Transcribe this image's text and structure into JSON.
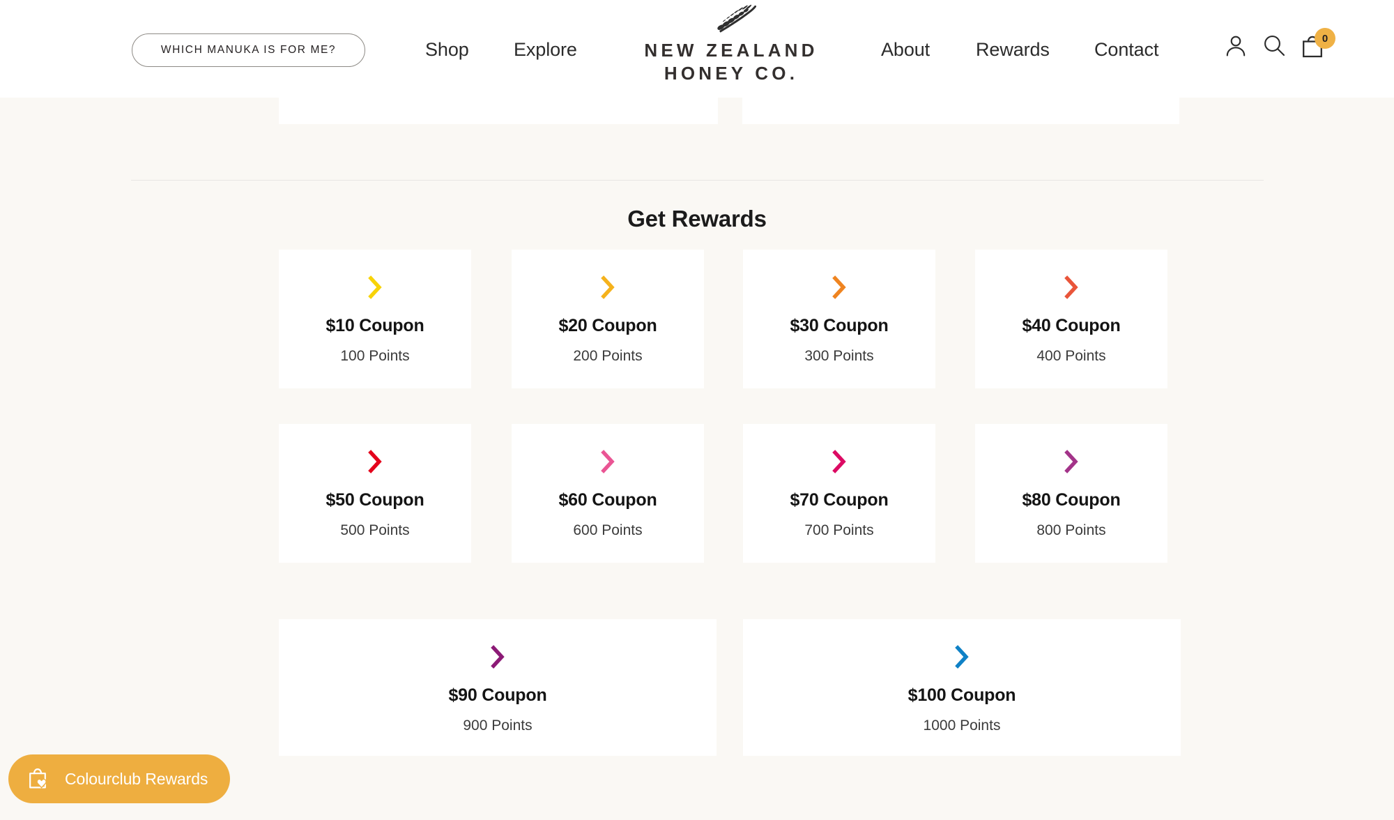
{
  "header": {
    "cta_button": "WHICH MANUKA IS FOR ME?",
    "nav": [
      {
        "label": "Shop",
        "name": "nav-link-shop"
      },
      {
        "label": "Explore",
        "name": "nav-link-explore"
      },
      {
        "label": "About",
        "name": "nav-link-about"
      },
      {
        "label": "Rewards",
        "name": "nav-link-rewards"
      },
      {
        "label": "Contact",
        "name": "nav-link-contact"
      }
    ],
    "logo": {
      "line1": "NEW ZEALAND",
      "line2": "HONEY CO.",
      "icon": "fern-leaf-icon"
    },
    "icons": {
      "account": "account-icon",
      "search": "search-icon",
      "cart": "cart-bag-icon"
    },
    "cart_count": "0",
    "cart_badge_color": "#efb145"
  },
  "main": {
    "section_title": "Get Rewards",
    "rewards": [
      {
        "title": "$10 Coupon",
        "points": "100 Points",
        "color": "#f8d308"
      },
      {
        "title": "$20 Coupon",
        "points": "200 Points",
        "color": "#f5b21c"
      },
      {
        "title": "$30 Coupon",
        "points": "300 Points",
        "color": "#ef8420"
      },
      {
        "title": "$40 Coupon",
        "points": "400 Points",
        "color": "#e9553a"
      },
      {
        "title": "$50 Coupon",
        "points": "500 Points",
        "color": "#e4021c"
      },
      {
        "title": "$60 Coupon",
        "points": "600 Points",
        "color": "#ea5594"
      },
      {
        "title": "$70 Coupon",
        "points": "700 Points",
        "color": "#dc0a63"
      },
      {
        "title": "$80 Coupon",
        "points": "800 Points",
        "color": "#a33389"
      },
      {
        "title": "$90 Coupon",
        "points": "900 Points",
        "color": "#8c1a76"
      },
      {
        "title": "$100 Coupon",
        "points": "1000 Points",
        "color": "#0f81c6"
      }
    ]
  },
  "widget": {
    "label": "Colourclub Rewards",
    "icon": "shopping-bag-heart-icon",
    "background_color": "#eeae40"
  },
  "theme": {
    "page_background": "#faf8f4",
    "card_background": "#ffffff",
    "text_color": "#231f20"
  }
}
